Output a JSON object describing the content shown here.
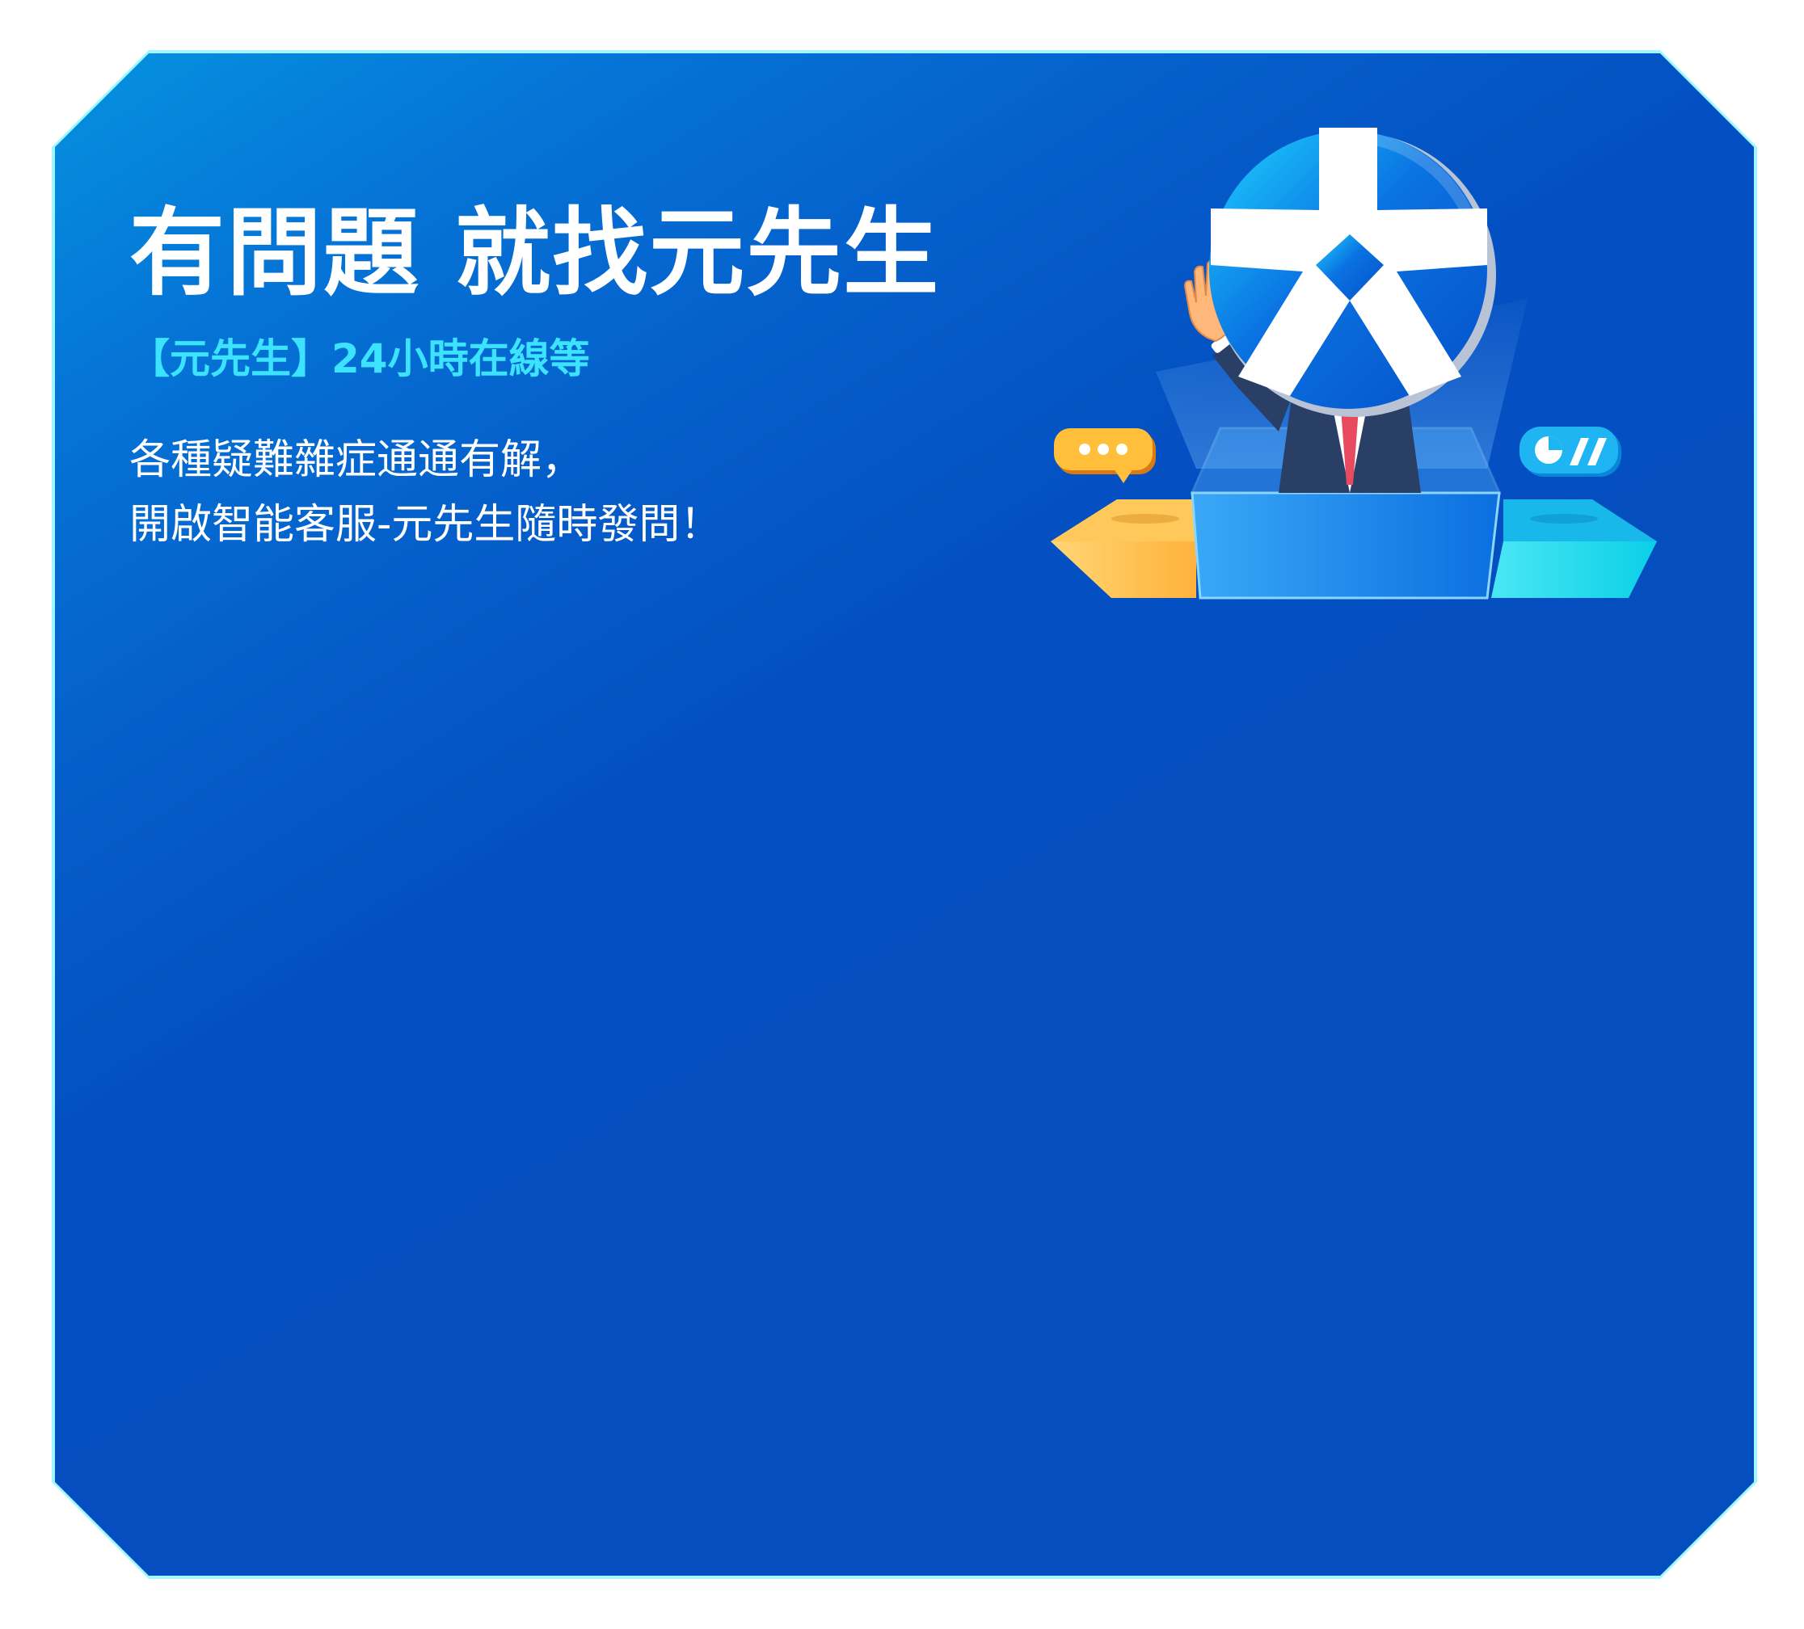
{
  "banner": {
    "headline": "有問題 就找元先生",
    "subtitle": "【元先生】24小時在線等",
    "description_lines": [
      "各種疑難雜症通通有解，",
      "開啟智能客服-元先生隨時發問！"
    ]
  },
  "illustration": {
    "mascot_icon": "yuanta-logo-head-icon",
    "left_bubble_icon": "chat-bubble-icon",
    "right_bubble_icon": "pie-chart-icon"
  },
  "colors": {
    "card_gradient_start": "#0592e0",
    "card_gradient_end": "#044ec0",
    "border_glow": "#7ff6ff",
    "subtitle": "#3ce3ff",
    "text": "#ffffff",
    "tie": "#e84a5f",
    "left_block": "#ffb84a",
    "right_block": "#10d6e8"
  }
}
